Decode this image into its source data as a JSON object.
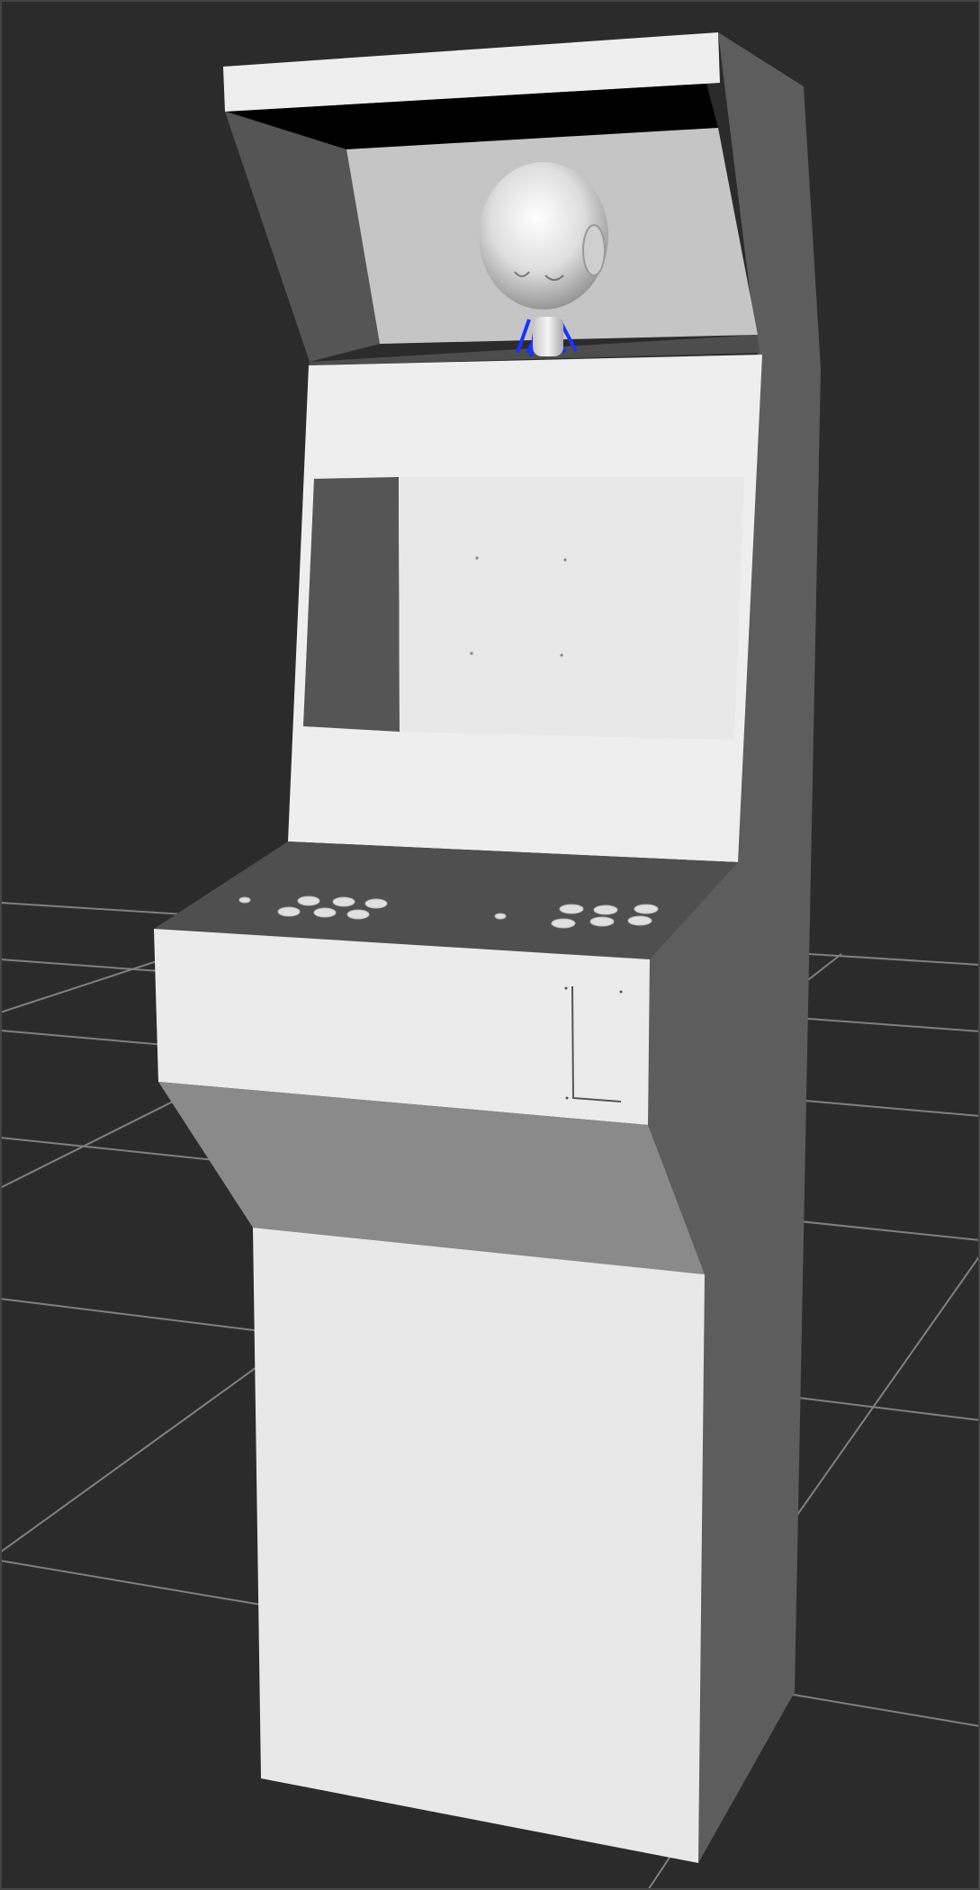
{
  "viewer": {
    "background_color": "#2b2b2b",
    "grid_line_color": "#8a8a8a"
  },
  "model": {
    "kind": "arcade cabinet with robot head",
    "colors": {
      "panel_light": "#eeeeee",
      "panel_mid": "#e8e8e8",
      "side_dark": "#5d5d5d",
      "screen_black": "#000000",
      "marquee_inner": "#c5c5c5",
      "control_deck": "#4f4f4f",
      "kick_slope": "#8a8a8a",
      "robot_head": "#f2f2f2",
      "robot_neck_wires": "#1a33ff"
    },
    "control_deck": {
      "player_one_buttons": 6,
      "player_two_buttons": 6
    }
  }
}
